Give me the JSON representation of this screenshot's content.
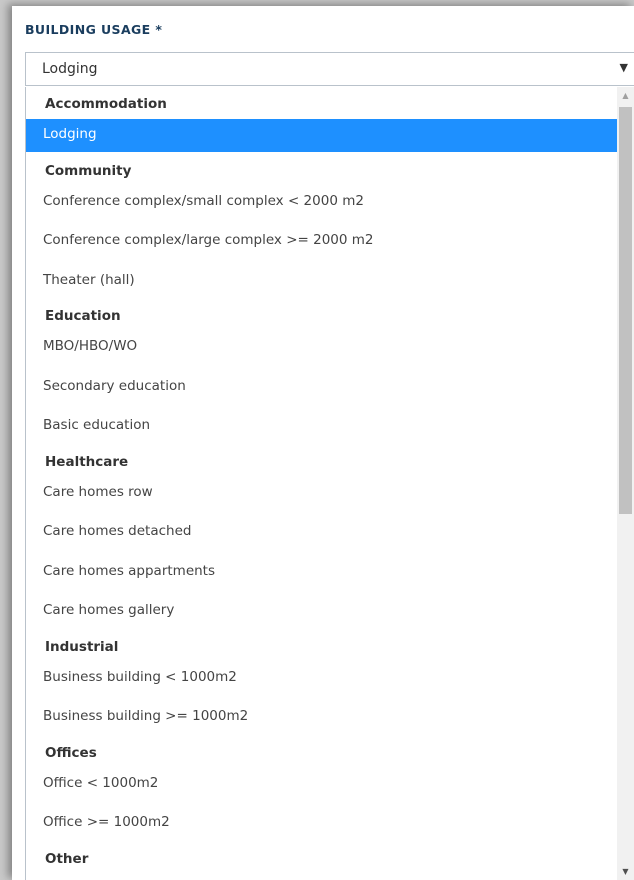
{
  "field": {
    "label": "BUILDING USAGE *",
    "selected_value": "Lodging",
    "arrow": "▼"
  },
  "dropdown": {
    "items": [
      {
        "text": "Accommodation",
        "kind": "group"
      },
      {
        "text": "Lodging",
        "kind": "option",
        "selected": true
      },
      {
        "text": "Community",
        "kind": "group"
      },
      {
        "text": "Conference complex/small complex < 2000 m2",
        "kind": "option"
      },
      {
        "text": "Conference complex/large complex >= 2000 m2",
        "kind": "option"
      },
      {
        "text": "Theater (hall)",
        "kind": "option"
      },
      {
        "text": "Education",
        "kind": "group"
      },
      {
        "text": "MBO/HBO/WO",
        "kind": "option"
      },
      {
        "text": "Secondary education",
        "kind": "option"
      },
      {
        "text": "Basic education",
        "kind": "option"
      },
      {
        "text": "Healthcare",
        "kind": "group"
      },
      {
        "text": "Care homes row",
        "kind": "option"
      },
      {
        "text": "Care homes detached",
        "kind": "option"
      },
      {
        "text": "Care homes appartments",
        "kind": "option"
      },
      {
        "text": "Care homes gallery",
        "kind": "option"
      },
      {
        "text": "Industrial",
        "kind": "group"
      },
      {
        "text": "Business building < 1000m2",
        "kind": "option"
      },
      {
        "text": "Business building >= 1000m2",
        "kind": "option"
      },
      {
        "text": "Offices",
        "kind": "group"
      },
      {
        "text": "Office < 1000m2",
        "kind": "option"
      },
      {
        "text": "Office >= 1000m2",
        "kind": "option"
      },
      {
        "text": "Other",
        "kind": "group"
      }
    ]
  },
  "scrollbar": {
    "up_arrow": "▲",
    "down_arrow": "▼"
  },
  "colors": {
    "selected_bg": "#1e90ff",
    "label_color": "#1a3d5e"
  }
}
